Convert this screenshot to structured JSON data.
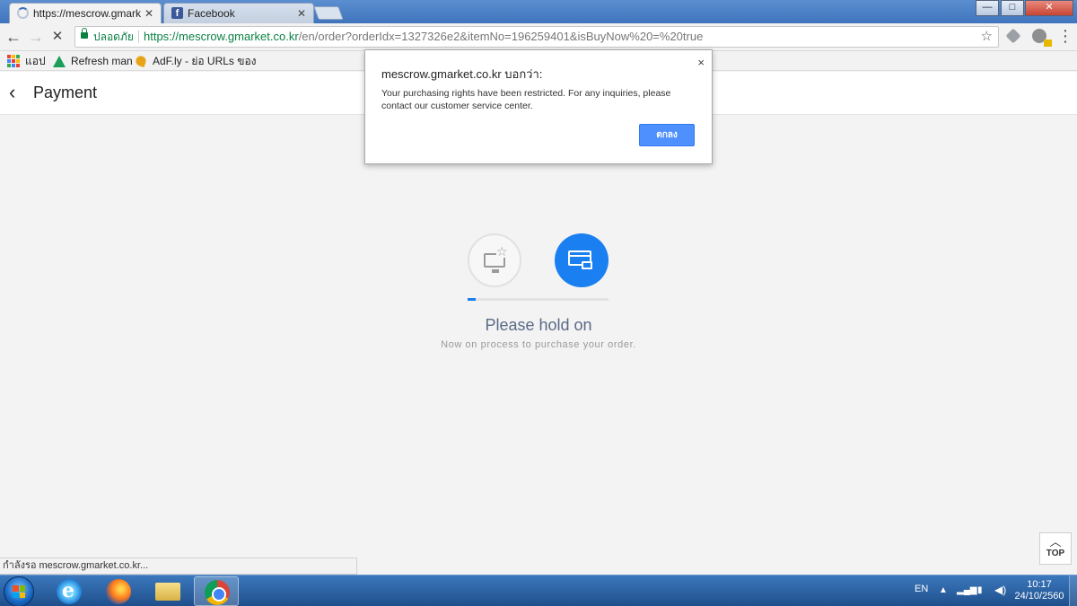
{
  "browser": {
    "tabs": [
      {
        "title": "https://mescrow.gmarket",
        "close": "✕"
      },
      {
        "title": "Facebook",
        "close": "✕"
      }
    ],
    "window_controls": {
      "minimize": "—",
      "maximize": "□",
      "close": "✕"
    },
    "nav": {
      "back": "←",
      "forward": "→",
      "reload": "✕"
    },
    "omnibox": {
      "secure_label": "ปลอดภัย",
      "url_scheme": "https://",
      "url_host": "mescrow.gmarket.co.kr",
      "url_path": "/en/order?orderIdx=1327326e2&itemNo=196259401&isBuyNow%20=%20true",
      "star": "☆"
    },
    "menu": "⋮",
    "bookmarks": [
      {
        "label": "แอป",
        "icon": "apps-grid-icon"
      },
      {
        "label": "Refresh man",
        "icon": "drive-icon"
      },
      {
        "label": "AdF.ly - ย่อ URLs ของ",
        "icon": "adfly-icon"
      }
    ],
    "status_text": "กำลังรอ mescrow.gmarket.co.kr..."
  },
  "page": {
    "back": "‹",
    "title": "Payment",
    "hold_title": "Please hold on",
    "hold_subtitle": "Now on process to purchase your order.",
    "progress_fraction": 0.06,
    "top_button": {
      "arrow": "︿",
      "label": "TOP"
    }
  },
  "dialog": {
    "title": "mescrow.gmarket.co.kr บอกว่า:",
    "message": "Your purchasing rights have been restricted. For any inquiries, please contact our customer service center.",
    "ok_label": "ตกลง",
    "close": "×"
  },
  "taskbar": {
    "language": "EN",
    "tray_arrow": "▲",
    "time": "10:17",
    "date": "24/10/2560"
  },
  "colors": {
    "accent": "#1a7ff0",
    "secure_green": "#0b8043",
    "dialog_button": "#4d90fe"
  }
}
